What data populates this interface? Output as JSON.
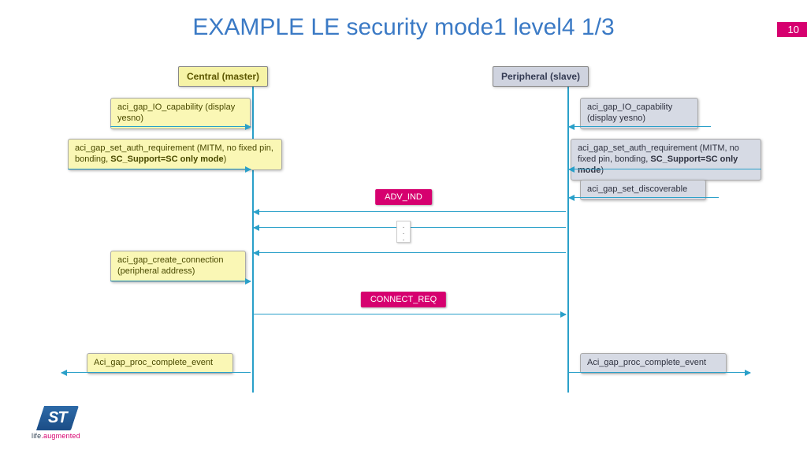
{
  "title": "EXAMPLE LE security mode1 level4 1/3",
  "page_number": "10",
  "headers": {
    "central": "Central (master)",
    "peripheral": "Peripheral (slave)"
  },
  "central_calls": {
    "io_cap": "aci_gap_IO_capability (display yesno)",
    "auth_pre": "aci_gap_set_auth_requirement (MITM, no fixed pin, bonding, ",
    "auth_bold": "SC_Support=SC only mode",
    "auth_post": ")",
    "create_conn": "aci_gap_create_connection (peripheral address)",
    "proc_complete": "Aci_gap_proc_complete_event"
  },
  "peripheral_calls": {
    "io_cap": "aci_gap_IO_capability (display yesno)",
    "auth_pre": "aci_gap_set_auth_requirement (MITM, no fixed pin, bonding, ",
    "auth_bold": "SC_Support=SC only mode",
    "auth_post": ")",
    "discoverable": "aci_gap_set_discoverable",
    "proc_complete": "Aci_gap_proc_complete_event"
  },
  "messages": {
    "adv": "ADV_IND",
    "connect": "CONNECT_REQ"
  },
  "logo": {
    "brand": "ST",
    "tag1": "life",
    "tag2": ".augmented"
  }
}
